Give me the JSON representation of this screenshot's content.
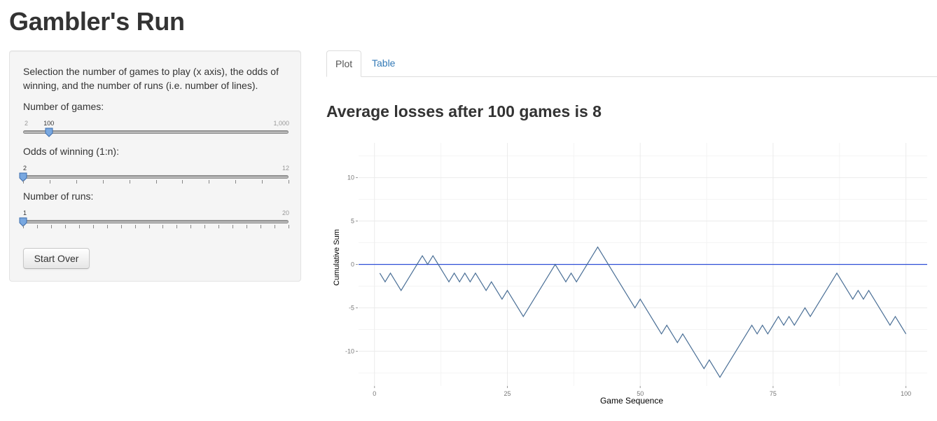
{
  "app": {
    "title": "Gambler's Run"
  },
  "sidebar": {
    "help": "Selection the number of games to play (x axis), the odds of winning, and the number of runs (i.e. number of lines).",
    "sliders": [
      {
        "label": "Number of games:",
        "min": "2",
        "max": "1,000",
        "value": "100",
        "min_num": 2,
        "max_num": 1000,
        "value_num": 100,
        "ticks": 0
      },
      {
        "label": "Odds of winning (1:n):",
        "min": "2",
        "max": "12",
        "value": "2",
        "min_num": 2,
        "max_num": 12,
        "value_num": 2,
        "ticks": 11
      },
      {
        "label": "Number of runs:",
        "min": "1",
        "max": "20",
        "value": "1",
        "min_num": 1,
        "max_num": 20,
        "value_num": 1,
        "ticks": 20
      }
    ],
    "start_over_label": "Start Over"
  },
  "tabs": [
    {
      "label": "Plot",
      "active": true
    },
    {
      "label": "Table",
      "active": false
    }
  ],
  "plot": {
    "heading": "Average losses after 100 games is 8"
  },
  "colors": {
    "line": "#4a6f96",
    "reference": "#2f4fd6",
    "link": "#337ab7"
  },
  "chart_data": {
    "type": "line",
    "xlabel": "Game Sequence",
    "ylabel": "Cumulative Sum",
    "xlim": [
      -3,
      104
    ],
    "ylim": [
      -14,
      14
    ],
    "xticks": [
      0,
      25,
      50,
      75,
      100
    ],
    "yticks": [
      -10,
      -5,
      0,
      5,
      10
    ],
    "reference_line_y": 0,
    "grid": true,
    "x_start": 1,
    "series": [
      {
        "values": [
          -1,
          -2,
          -1,
          -2,
          -3,
          -2,
          -1,
          0,
          1,
          0,
          1,
          0,
          -1,
          -2,
          -1,
          -2,
          -1,
          -2,
          -1,
          -2,
          -3,
          -2,
          -3,
          -4,
          -3,
          -4,
          -5,
          -6,
          -5,
          -4,
          -3,
          -2,
          -1,
          0,
          -1,
          -2,
          -1,
          -2,
          -1,
          0,
          1,
          2,
          1,
          0,
          -1,
          -2,
          -3,
          -4,
          -5,
          -4,
          -5,
          -6,
          -7,
          -8,
          -7,
          -8,
          -9,
          -8,
          -9,
          -10,
          -11,
          -12,
          -11,
          -12,
          -13,
          -12,
          -11,
          -10,
          -9,
          -8,
          -7,
          -8,
          -7,
          -8,
          -7,
          -6,
          -7,
          -6,
          -7,
          -6,
          -5,
          -6,
          -5,
          -4,
          -3,
          -2,
          -1,
          -2,
          -3,
          -4,
          -3,
          -4,
          -3,
          -4,
          -5,
          -6,
          -7,
          -6,
          -7,
          -8
        ]
      }
    ]
  }
}
